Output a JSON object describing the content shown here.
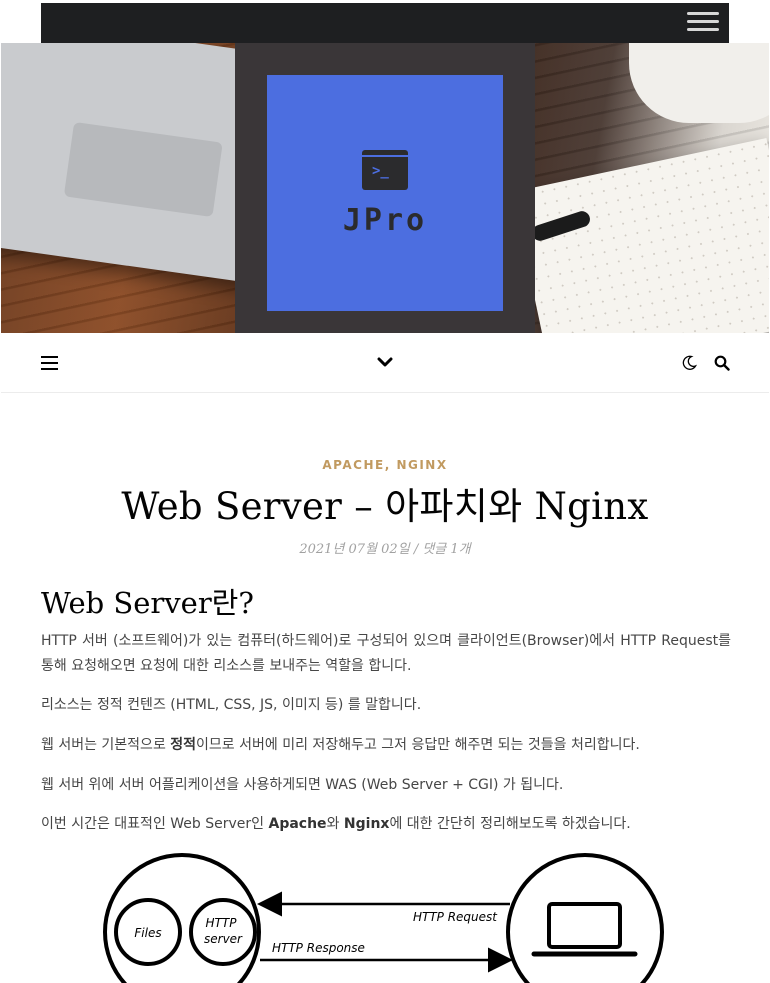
{
  "header": {
    "logo_text": "JPro",
    "terminal_prompt": ">_"
  },
  "post": {
    "categories": [
      "APACHE",
      "NGINX"
    ],
    "category_separator": ",",
    "title": "Web Server – 아파치와 Nginx",
    "date": "2021년 07월 02일",
    "meta_separator": "/",
    "comments": "댓글 1개",
    "section_heading": "Web Server란?",
    "paragraphs": {
      "p1": "HTTP 서버 (소프트웨어)가 있는 컴퓨터(하드웨어)로 구성되어 있으며 클라이언트(Browser)에서 HTTP Request를 통해 요청해오면 요청에 대한 리소스를 보내주는 역할을 합니다.",
      "p2": "리소스는 정적 컨텐즈 (HTML, CSS, JS, 이미지 등) 를 말합니다.",
      "p3_before": "웹 서버는 기본적으로 ",
      "p3_bold": "정적",
      "p3_after": "이므로 서버에 미리 저장해두고 그저 응답만 해주면 되는 것들을 처리합니다.",
      "p4": "웹 서버 위에 서버 어플리케이션을 사용하게되면 WAS (Web Server + CGI) 가 됩니다.",
      "p5_before": "이번 시간은 대표적인 Web Server인 ",
      "p5_bold1": "Apache",
      "p5_mid": "와 ",
      "p5_bold2": "Nginx",
      "p5_after": "에 대한 간단히 정리해보도록 하겠습니다."
    }
  },
  "diagram": {
    "files_label": "Files",
    "http_label_1": "HTTP",
    "http_label_2": "server",
    "request_label": "HTTP Request",
    "response_label": "HTTP Response"
  },
  "icons": {
    "top_menu": "hamburger-icon",
    "nav_menu": "hamburger-icon",
    "nav_center": "chevron-down-icon",
    "dark_mode": "moon-icon",
    "search": "search-icon",
    "logo": "terminal-icon",
    "client": "laptop-icon"
  },
  "colors": {
    "topbar": "#1e1f21",
    "logo_blue": "#4c6ee0",
    "logo_panel": "#3a3638",
    "category": "#c19a60",
    "title": "#030303",
    "meta": "#a1a1a1",
    "body_text": "#464646"
  }
}
